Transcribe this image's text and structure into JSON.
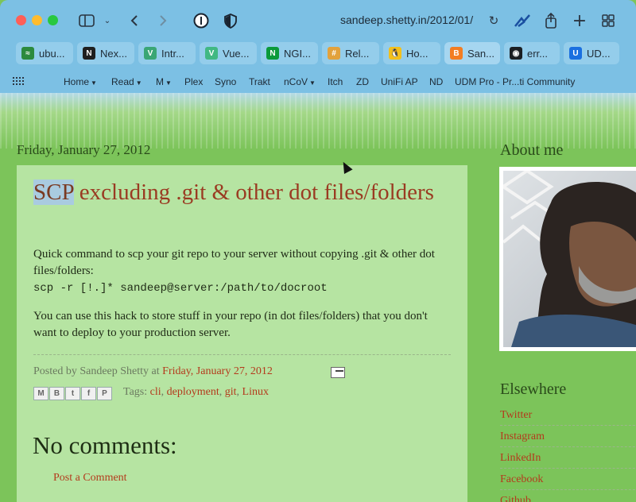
{
  "browser": {
    "url": "sandeep.shetty.in/2012/01/",
    "tabs": [
      {
        "label": "ubu...",
        "fav_color": "#2c8a3e",
        "fav_glyph": "≈"
      },
      {
        "label": "Nex...",
        "fav_color": "#1f1f1f",
        "fav_glyph": "N"
      },
      {
        "label": "Intr...",
        "fav_color": "#3aa675",
        "fav_glyph": "V"
      },
      {
        "label": "Vue...",
        "fav_color": "#41b883",
        "fav_glyph": "V"
      },
      {
        "label": "NGI...",
        "fav_color": "#0b9a3a",
        "fav_glyph": "N"
      },
      {
        "label": "Rel...",
        "fav_color": "#e2a23c",
        "fav_glyph": "#"
      },
      {
        "label": "Ho...",
        "fav_color": "#f3c01b",
        "fav_glyph": "🐧"
      },
      {
        "label": "San...",
        "fav_color": "#f37d22",
        "fav_glyph": "B"
      },
      {
        "label": "err...",
        "fav_color": "#1b1f23",
        "fav_glyph": "◉"
      },
      {
        "label": "UD...",
        "fav_color": "#1a6fe0",
        "fav_glyph": "U"
      }
    ],
    "bookmarks": [
      {
        "label": "Home",
        "menu": true
      },
      {
        "label": "Read",
        "menu": true
      },
      {
        "label": "M",
        "menu": true
      },
      {
        "label": "Plex",
        "menu": false
      },
      {
        "label": "Syno",
        "menu": false
      },
      {
        "label": "Trakt",
        "menu": false
      },
      {
        "label": "nCoV",
        "menu": true
      },
      {
        "label": "Itch",
        "menu": false
      },
      {
        "label": "ZD",
        "menu": false
      },
      {
        "label": "UniFi AP",
        "menu": false
      },
      {
        "label": "ND",
        "menu": false
      },
      {
        "label": "UDM Pro - Pr...ti Community",
        "menu": false
      }
    ]
  },
  "post": {
    "date_header": "Friday, January 27, 2012",
    "title_highlight": "SCP",
    "title_rest": " excluding .git & other dot files/folders",
    "body_line1": "Quick command to scp your git repo to your server without copying .git & other dot files/folders:",
    "command": "scp -r [!.]* sandeep@server:/path/to/docroot",
    "body_line2": "You can use this hack to store stuff in your repo (in dot files/folders) that you don't want to deploy to your production server.",
    "posted_by": "Posted by Sandeep Shetty at ",
    "posted_time": "Friday, January 27, 2012",
    "tags_label": "Tags: ",
    "tags": [
      "cli",
      "deployment",
      "git",
      "Linux"
    ],
    "share_buttons": [
      "M",
      "B",
      "t",
      "f",
      "P"
    ],
    "comments_heading": "No comments:",
    "post_comment": "Post a Comment"
  },
  "sidebar": {
    "about_heading": "About me",
    "elsewhere_heading": "Elsewhere",
    "links": [
      "Twitter",
      "Instagram",
      "LinkedIn",
      "Facebook",
      "Github"
    ]
  }
}
